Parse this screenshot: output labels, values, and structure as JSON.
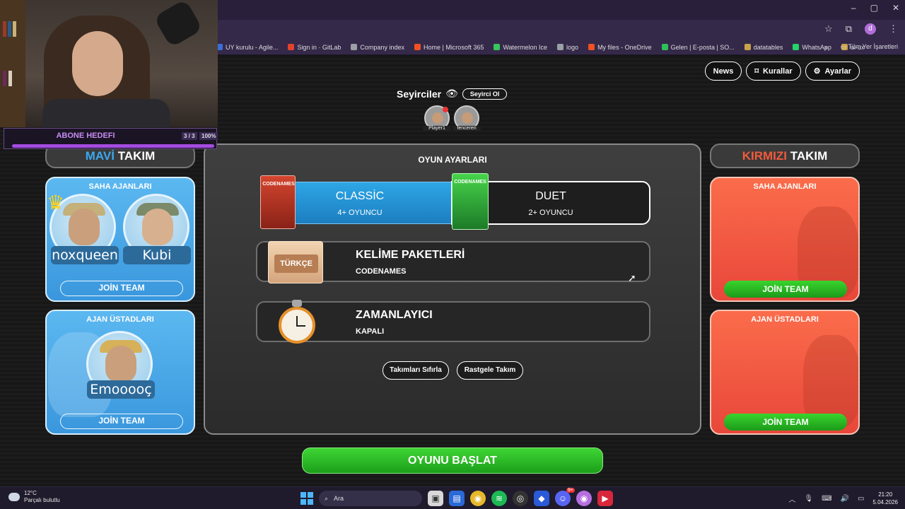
{
  "browser": {
    "window_controls": [
      "–",
      "▢",
      "✕"
    ],
    "bookmarks": [
      {
        "label": "UY kurulu - Agile...",
        "color": "#3a6fd8"
      },
      {
        "label": "Sign in · GitLab",
        "color": "#e2432a"
      },
      {
        "label": "Company index",
        "color": "#9aa0a6"
      },
      {
        "label": "Home | Microsoft 365",
        "color": "#f25022"
      },
      {
        "label": "Watermelon Ice",
        "color": "#34c759"
      },
      {
        "label": "logo",
        "color": "#9aa0a6"
      },
      {
        "label": "My files - OneDrive",
        "color": "#f25022"
      },
      {
        "label": "Gelen | E-posta | SO...",
        "color": "#2fbf5a"
      },
      {
        "label": "datatables",
        "color": "#c9a34a"
      },
      {
        "label": "WhatsApp",
        "color": "#25d366"
      },
      {
        "label": "ui-ux",
        "color": "#c9a34a"
      }
    ],
    "bookmarks_more": "»",
    "all_bookmarks": "Tüm Yer İşaretleri",
    "profile_initial": "d"
  },
  "stream_overlay": {
    "goal_title": "ABONE HEDEFI",
    "goal_count": "3 / 3",
    "goal_percent": "100%",
    "goal_fraction": 1.0
  },
  "header": {
    "news": "News",
    "rules": "Kurallar",
    "settings": "Ayarlar"
  },
  "spectators": {
    "title": "Seyirciler",
    "become_spectator": "Seyirci Ol",
    "players": [
      "Player1",
      "fenceren"
    ]
  },
  "blue_team": {
    "title_colored": "MAVİ",
    "title_rest": "TAKIM",
    "field_agents_title": "SAHA AJANLARI",
    "field_agents": [
      "noxqueen",
      "Kubi"
    ],
    "spymasters_title": "AJAN ÜSTADLARI",
    "spymasters": [
      "Emooooç"
    ],
    "join_label": "JOİN TEAM"
  },
  "red_team": {
    "title_colored": "KIRMIZI",
    "title_rest": "TAKIM",
    "field_agents_title": "SAHA AJANLARI",
    "spymasters_title": "AJAN ÜSTADLARI",
    "join_label": "JOİN TEAM"
  },
  "game_settings": {
    "title": "OYUN AYARLARI",
    "modes": [
      {
        "name": "CLASSİC",
        "players": "4+ OYUNCU",
        "box": "CODENAMES"
      },
      {
        "name": "DUET",
        "players": "2+ OYUNCU",
        "box": "CODENAMES"
      }
    ],
    "word_pack": {
      "title": "KELİME PAKETLERİ",
      "value": "CODENAMES",
      "badge": "TÜRKÇE"
    },
    "timer": {
      "title": "ZAMANLAYICI",
      "value": "KAPALI"
    },
    "reset_teams": "Takımları Sıfırla",
    "random_teams": "Rastgele Takım",
    "start_game": "OYUNU BAŞLAT"
  },
  "taskbar": {
    "temperature": "12°C",
    "weather": "Parçalı bulutlu",
    "search_placeholder": "Ara",
    "time": "21:20",
    "date": "5.04.2026",
    "notification_badge": "9+"
  }
}
